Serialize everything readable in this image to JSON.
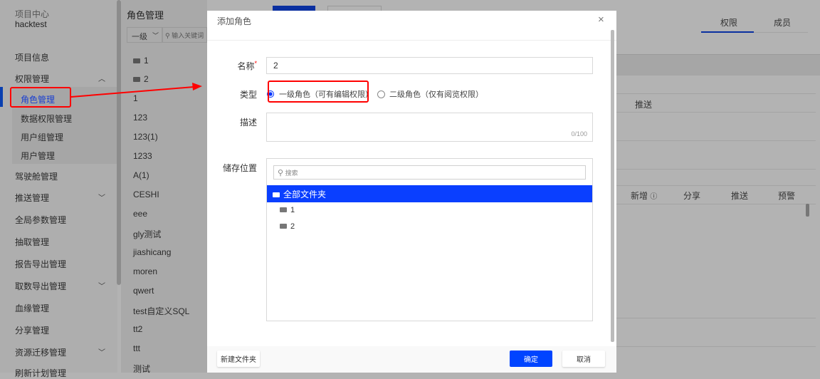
{
  "sidebar": {
    "project_label": "项目中心",
    "project_name": "hacktest",
    "items": [
      {
        "label": "项目信息"
      },
      {
        "label": "权限管理",
        "chevron": "up"
      },
      {
        "label": "角色管理",
        "active": true
      },
      {
        "label": "数据权限管理"
      },
      {
        "label": "用户组管理"
      },
      {
        "label": "用户管理"
      },
      {
        "label": "驾驶舱管理"
      },
      {
        "label": "推送管理",
        "chevron": "down"
      },
      {
        "label": "全局参数管理"
      },
      {
        "label": "抽取管理"
      },
      {
        "label": "报告导出管理"
      },
      {
        "label": "取数导出管理",
        "chevron": "down"
      },
      {
        "label": "血缘管理"
      },
      {
        "label": "分享管理"
      },
      {
        "label": "资源迁移管理",
        "chevron": "down"
      },
      {
        "label": "刷新计划管理"
      }
    ]
  },
  "role_panel": {
    "title": "角色管理",
    "level_select": "一级",
    "search_placeholder": "输入关键词",
    "items": [
      "1",
      "2",
      "1",
      "123",
      "123(1)",
      "1233",
      "A(1)",
      "CESHI",
      "eee",
      "gly测试",
      "jiashicang",
      "moren",
      "qwert",
      "test自定义SQL",
      "tt2",
      "ttt",
      "测试"
    ]
  },
  "background": {
    "tabs": [
      "权限",
      "成员"
    ],
    "col_push": "推送",
    "cols": [
      "新增",
      "分享",
      "推送",
      "预警"
    ]
  },
  "modal": {
    "title": "添加角色",
    "name_label": "名称",
    "required_mark": "*",
    "name_value": "2",
    "type_label": "类型",
    "type_options": [
      "一级角色（可有编辑权限）",
      "二级角色（仅有阅览权限）"
    ],
    "desc_label": "描述",
    "desc_counter": "0/100",
    "storage_label": "储存位置",
    "tree_search_placeholder": "搜索",
    "tree_root": "全部文件夹",
    "tree_children": [
      "1",
      "2"
    ],
    "new_folder_button": "新建文件夹",
    "confirm_button": "确定",
    "cancel_button": "取消"
  },
  "colors": {
    "accent": "#0044ff",
    "annotation": "#ff0000"
  }
}
